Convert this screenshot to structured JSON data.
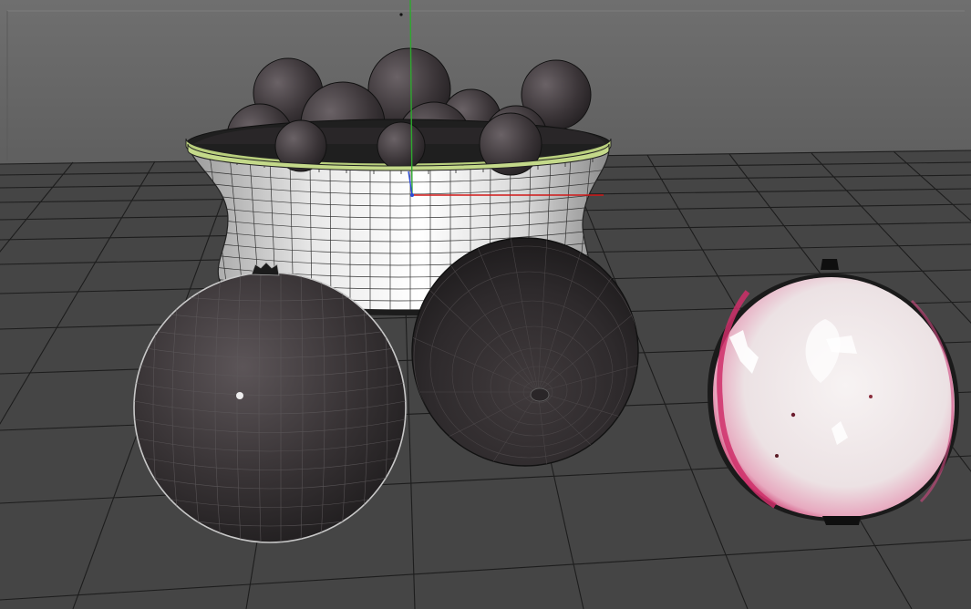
{
  "viewport": {
    "background_color": "#3b3b3b",
    "sky_color": "#6a6a6a",
    "grid_color": "#1a1a1a",
    "axis_x_color": "#d01818",
    "axis_y_color": "#2ea82e",
    "bowl_rim_color": "#c4d98a",
    "fruit_color": "#3a3538",
    "cut_flesh_color": "#f1ecec",
    "cut_skin_color": "#d03a72"
  },
  "objects": {
    "items": [
      {
        "name": "fruit-bowl",
        "icon": "bowl-wireframe"
      },
      {
        "name": "whole-pomegranate",
        "icon": "sphere-wireframe"
      },
      {
        "name": "pomegranate-bottom",
        "icon": "sphere-wireframe"
      },
      {
        "name": "pomegranate-half",
        "icon": "cut-fruit"
      }
    ]
  }
}
